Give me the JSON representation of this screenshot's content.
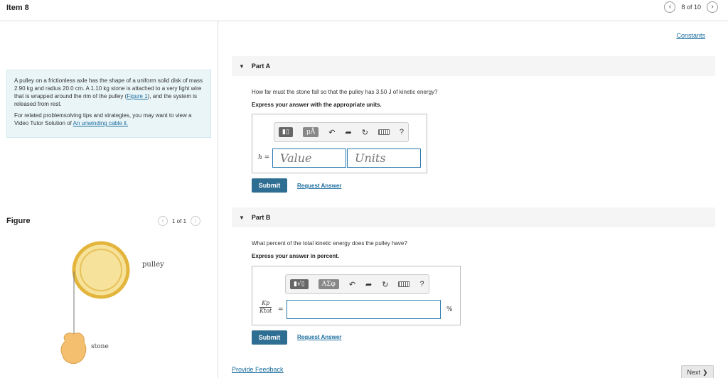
{
  "header": {
    "title": "Item 8",
    "page_count": "8 of 10",
    "prev": "‹",
    "next": "›"
  },
  "problem": {
    "p1": "A pulley on a frictionless axle has the shape of a uniform solid disk of mass 2.90 kg and radius 20.0 cm. A 1.10 kg stone is attached to a very light wire that is wrapped around the rim of the pulley (",
    "figure_link": "Figure 1",
    "p1_end": "), and the system is released from rest.",
    "p2": "For related problemsolving tips and strategies, you may want to view a Video Tutor Solution of ",
    "video_link": "An unwinding cable",
    "video_suffix": " ⅱ."
  },
  "figure": {
    "title": "Figure",
    "page_count": "1 of 1",
    "pulley_label": "pulley",
    "stone_label": "stone"
  },
  "constants_link": "Constants",
  "partA": {
    "label": "Part A",
    "question": "How far must the stone fall so that the pulley has 3.50 J of kinetic energy?",
    "instruction": "Express your answer with the appropriate units.",
    "var_label": "h =",
    "value_placeholder": "Value",
    "units_placeholder": "Units",
    "tool_mu": "μÅ",
    "submit": "Submit",
    "request": "Request Answer"
  },
  "partB": {
    "label": "Part B",
    "question": "What percent of the total kinetic energy does the pulley have?",
    "instruction": "Express your answer in percent.",
    "frac_num": "Kp",
    "frac_den": "Ktot",
    "equals": "=",
    "unit": "%",
    "tool_greek": "ΑΣφ",
    "submit": "Submit",
    "request": "Request Answer"
  },
  "tools": {
    "undo": "↶",
    "redo": "➦",
    "reset": "↻",
    "help": "?"
  },
  "footer": {
    "feedback": "Provide Feedback",
    "next": "Next",
    "next_icon": "❯"
  },
  "colors": {
    "accent": "#2e6e93",
    "link": "#1a6c9e",
    "pulley_fill": "#f6e29a",
    "pulley_rim": "#e3b53c",
    "stone": "#f4bf6e"
  }
}
